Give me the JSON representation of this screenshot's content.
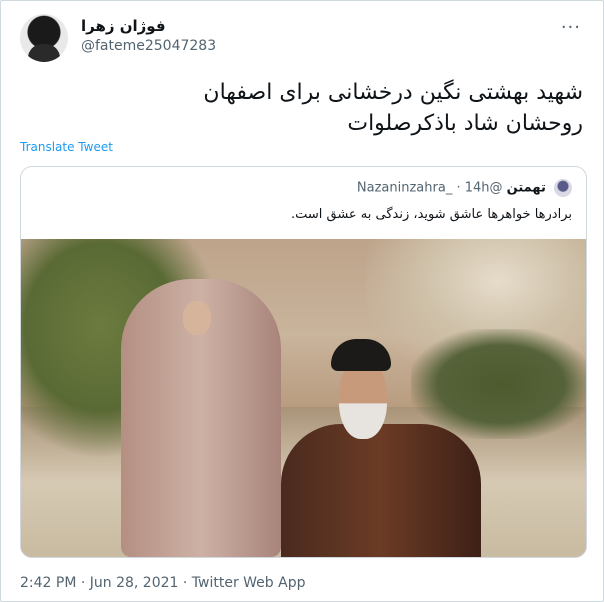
{
  "author": {
    "name": "فوژان زهرا",
    "handle": "@fateme25047283"
  },
  "tweet": {
    "lines": [
      "شهید بهشتی نگین درخشانی برای اصفهان",
      "روحشان شاد باذکرصلوات"
    ],
    "translate_label": "Translate Tweet",
    "more_label": "···"
  },
  "quoted": {
    "name": "تهمتن",
    "handle": "@Nazaninzahra_",
    "separator": "·",
    "time": "14h",
    "text": "برادرها خواهرها عاشق شوید، زندگی به عشق است."
  },
  "footer": {
    "timestamp": "2:42 PM · Jun 28, 2021 · Twitter Web App"
  }
}
